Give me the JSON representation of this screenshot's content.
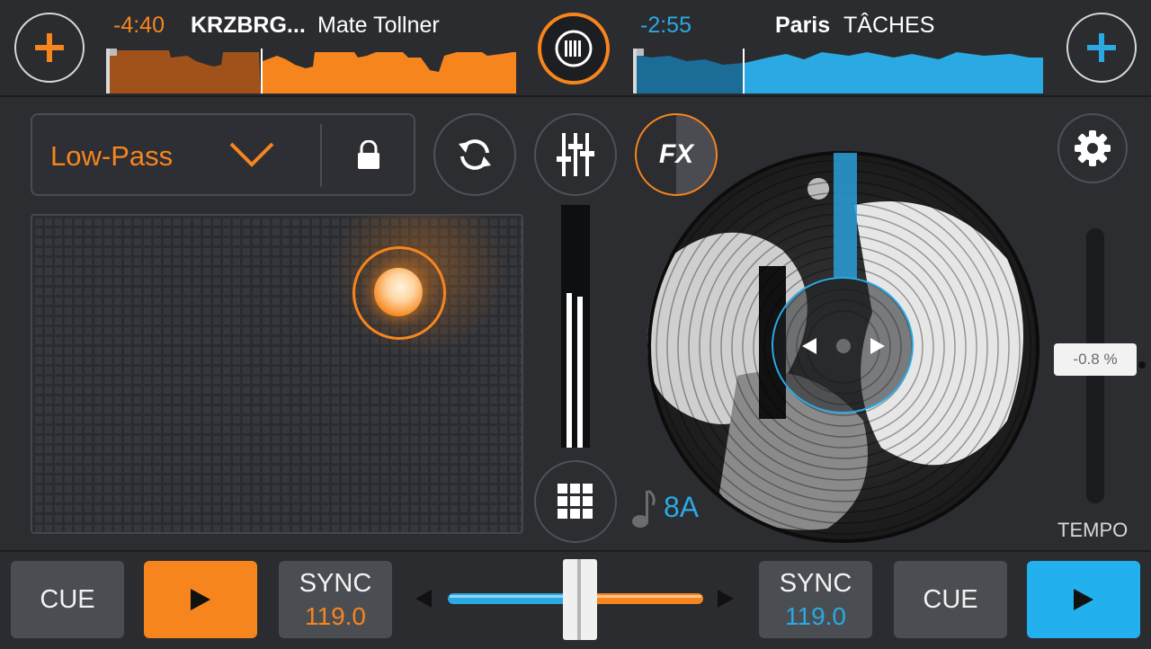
{
  "deck_a": {
    "time_remaining": "-4:40",
    "artist": "KRZBRG...",
    "title": "Mate Tollner",
    "accent_color": "#f7851d",
    "add_icon": "plus-icon",
    "cue_label": "CUE",
    "play_icon": "play-icon",
    "sync_label": "SYNC",
    "bpm": "119.0"
  },
  "deck_b": {
    "time_remaining": "-2:55",
    "artist": "Paris",
    "title": "TÂCHES",
    "accent_color": "#2aa9e3",
    "add_icon": "plus-icon",
    "cue_label": "CUE",
    "play_icon": "play-icon",
    "sync_label": "SYNC",
    "bpm": "119.0",
    "key": "8A"
  },
  "fx_panel": {
    "selected_effect": "Low-Pass",
    "dropdown_icon": "chevron-down-icon",
    "lock_icon": "lock-icon"
  },
  "center_controls": {
    "loop_icon": "loop-icon",
    "mixer_icon": "mixer-sliders-icon",
    "fx_label": "FX",
    "grid_icon": "grid-icon",
    "center_logo_icon": "app-logo-icon"
  },
  "tempo": {
    "readout": "-0.8 %",
    "label": "TEMPO"
  },
  "settings": {
    "icon": "gear-icon"
  }
}
